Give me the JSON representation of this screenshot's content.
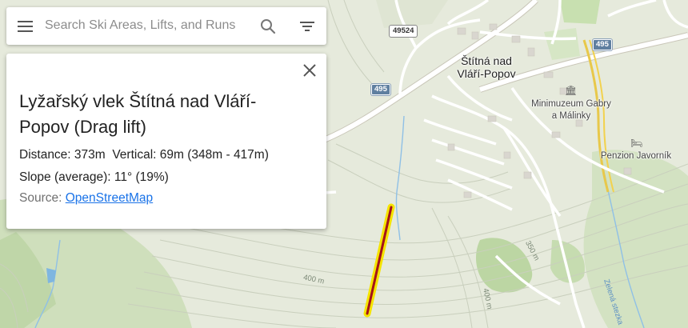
{
  "search": {
    "placeholder": "Search Ski Areas, Lifts, and Runs"
  },
  "icons": {
    "menu": "hamburger-menu-icon",
    "search": "magnifier-search-icon",
    "filter": "filter-lines-icon",
    "close": "close-x-icon",
    "museum": "museum-icon",
    "lodging": "bed-icon"
  },
  "info_card": {
    "title": "Lyžařský vlek Štítná nad Vláří-Popov (Drag lift)",
    "distance_text": "Distance: 373m",
    "vertical_text": "Vertical: 69m (348m - 417m)",
    "slope_text": "Slope (average): 11° (19%)",
    "source_label": "Source:",
    "source_link": "OpenStreetMap"
  },
  "map": {
    "town": "Štítná nad Vláří-Popov",
    "poi_museum": "Minimuzeum Gabry a Málinky",
    "poi_penzion": "Penzion Javorník",
    "road_495_a": "495",
    "road_495_b": "495",
    "road_49524": "49524",
    "contour_400_a": "400 m",
    "contour_400_b": "400 m",
    "contour_350": "350 m",
    "trail_label": "Zelená stezka"
  },
  "colors": {
    "map_background": "#e6eadc",
    "forest": "#c8dcb4",
    "road": "#ffffff",
    "highway": "#f2d24e",
    "water": "#7fb6e0",
    "lift_highlight": "#f5e400",
    "lift_line": "#a4131b",
    "link": "#1a73e8"
  }
}
